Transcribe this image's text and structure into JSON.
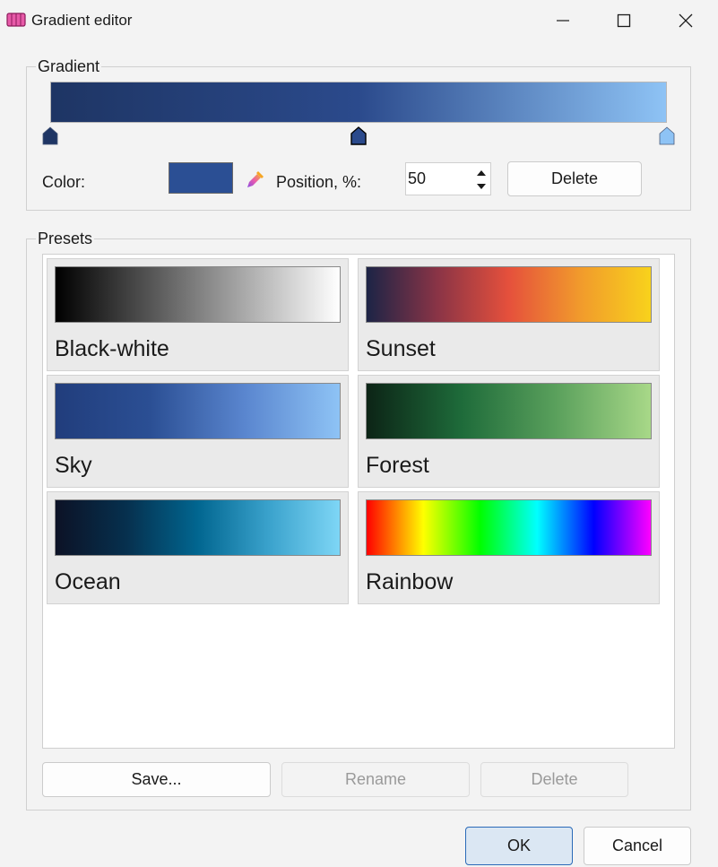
{
  "window": {
    "title": "Gradient editor"
  },
  "gradient_group": {
    "legend": "Gradient",
    "stops": [
      {
        "color": "#1e3564",
        "position": 0
      },
      {
        "color": "#2b4a8c",
        "position": 50,
        "selected": true
      },
      {
        "color": "#8ec3f5",
        "position": 100
      }
    ],
    "color_label": "Color:",
    "color_value": "#2b4f94",
    "position_label": "Position, %:",
    "position_value": "50",
    "delete_label": "Delete"
  },
  "presets_group": {
    "legend": "Presets",
    "items": [
      {
        "name": "Black-white",
        "colors": [
          "#000000",
          "#ffffff"
        ]
      },
      {
        "name": "Sunset",
        "colors": [
          "#1c2446",
          "#8a3446",
          "#e5503c",
          "#f19a2c",
          "#f8d21c"
        ]
      },
      {
        "name": "Sky",
        "colors": [
          "#213d7c",
          "#2b4f94",
          "#5a86cf",
          "#8ec3f5"
        ]
      },
      {
        "name": "Forest",
        "colors": [
          "#0c2416",
          "#1e6b3a",
          "#5aa05c",
          "#a8d888"
        ]
      },
      {
        "name": "Ocean",
        "colors": [
          "#0c1226",
          "#06304e",
          "#016690",
          "#3aa2cc",
          "#7ed6f6"
        ]
      },
      {
        "name": "Rainbow",
        "colors": [
          "#ff0000",
          "#ffff00",
          "#00ff00",
          "#00ffff",
          "#0000ff",
          "#ff00ff"
        ]
      }
    ],
    "save_label": "Save...",
    "rename_label": "Rename",
    "delete_label": "Delete"
  },
  "footer": {
    "ok_label": "OK",
    "cancel_label": "Cancel"
  }
}
